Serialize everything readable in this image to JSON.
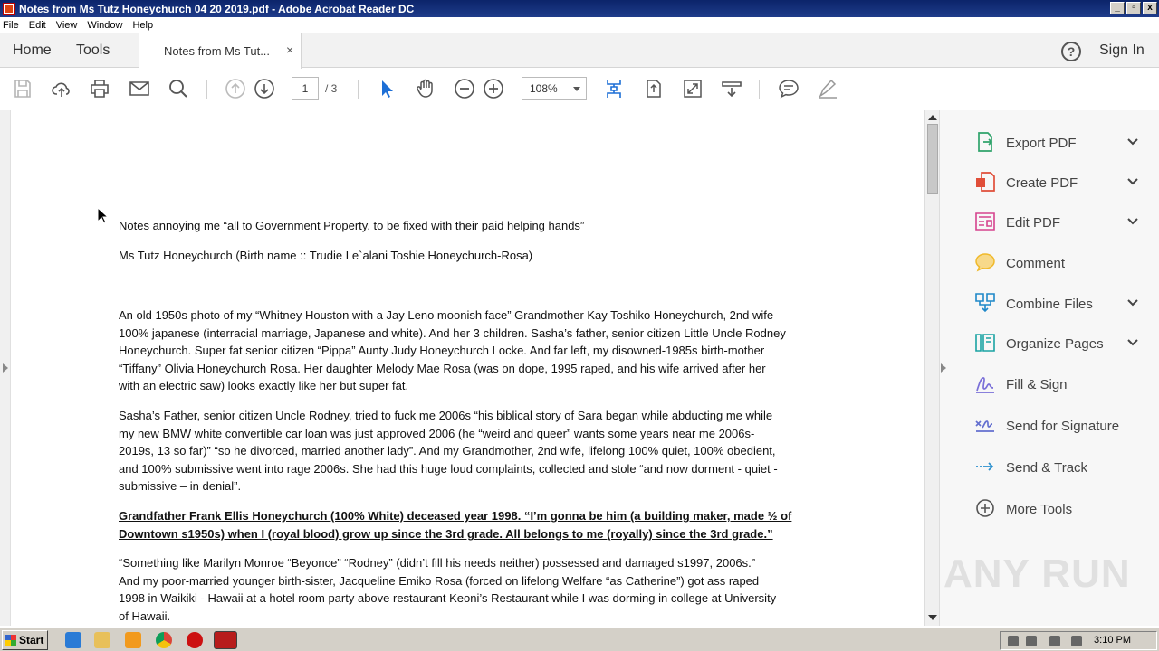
{
  "window": {
    "title": "Notes from Ms Tutz Honeychurch 04 20 2019.pdf - Adobe Acrobat Reader DC",
    "min": "_",
    "max": "▫",
    "close": "x"
  },
  "menu": [
    "File",
    "Edit",
    "View",
    "Window",
    "Help"
  ],
  "tabs": {
    "home": "Home",
    "tools": "Tools",
    "doc": "Notes from Ms Tut...",
    "close": "×",
    "help": "?",
    "signin": "Sign In"
  },
  "toolbar": {
    "page_current": "1",
    "page_total": "/ 3",
    "zoom": "108%"
  },
  "document": {
    "lines": [
      "Notes annoying me  “all to Government Property, to be fixed with their paid helping hands”",
      "Ms Tutz Honeychurch  (Birth name ::  Trudie Le`alani Toshie Honeychurch-Rosa)",
      "An old 1950s photo of my “Whitney Houston with a Jay Leno moonish face” Grandmother Kay Toshiko Honeychurch, 2nd wife",
      "100% japanese (interracial marriage, Japanese and white).  And her 3 children.  Sasha’s father, senior citizen Little Uncle Rodney",
      "Honeychurch.  Super fat senior citizen “Pippa” Aunty Judy Honeychurch Locke.  And far left, my disowned-1985s birth-mother",
      "“Tiffany” Olivia Honeychurch Rosa.  Her daughter Melody Mae Rosa (was on dope, 1995 raped, and his wife arrived after her",
      "with an electric saw)  looks exactly like her but super fat.",
      "Sasha’s Father, senior citizen Uncle Rodney, tried to fuck me 2006s “his biblical story of Sara began while abducting me while",
      "my new BMW white convertible car loan was just approved 2006 (he “weird and queer” wants some years near me 2006s-",
      "2019s, 13 so far)” “so he divorced, married another lady”.  And my Grandmother, 2nd wife, lifelong 100% quiet, 100% obedient,",
      "and 100% submissive went into rage 2006s.  She had this huge loud complaints, collected and stole “and now dorment - quiet -",
      "submissive – in denial”.",
      "Grandfather Frank Ellis Honeychurch (100% White) deceased year 1998. “I’m gonna be him (a building maker, made ½ of",
      "Downtown s1950s) when I (royal blood) grow up since the 3rd grade.  All belongs to me (royally) since the 3rd grade.”",
      "“Something like Marilyn Monroe “Beyonce” “Rodney”  (didn’t fill his needs neither) possessed and damaged s1997, 2006s.”",
      "And my poor-married younger birth-sister, Jacqueline Emiko Rosa (forced on lifelong Welfare “as Catherine”) got ass raped",
      "1998 in Waikiki - Hawaii at a hotel room party above restaurant  Keoni’s Restaurant while I was dorming in college at  University",
      "of Hawaii."
    ]
  },
  "tools": [
    {
      "label": "Export PDF",
      "icon": "export-pdf-icon",
      "color": "#2fa36b"
    },
    {
      "label": "Create PDF",
      "icon": "create-pdf-icon",
      "color": "#e04e39"
    },
    {
      "label": "Edit PDF",
      "icon": "edit-pdf-icon",
      "color": "#d6438e"
    },
    {
      "label": "Comment",
      "icon": "comment-icon",
      "color": "#f0b92a"
    },
    {
      "label": "Combine Files",
      "icon": "combine-files-icon",
      "color": "#1f88c9"
    },
    {
      "label": "Organize Pages",
      "icon": "organize-pages-icon",
      "color": "#1aa3a3"
    },
    {
      "label": "Fill & Sign",
      "icon": "fill-sign-icon",
      "color": "#7a6fd8"
    },
    {
      "label": "Send for Signature",
      "icon": "send-signature-icon",
      "color": "#6470cf"
    },
    {
      "label": "Send & Track",
      "icon": "send-track-icon",
      "color": "#2a8fce"
    },
    {
      "label": "More Tools",
      "icon": "more-tools-icon",
      "color": "#555555"
    }
  ],
  "watermark": "ANY RUN",
  "taskbar": {
    "start": "Start",
    "clock": "3:10 PM"
  }
}
